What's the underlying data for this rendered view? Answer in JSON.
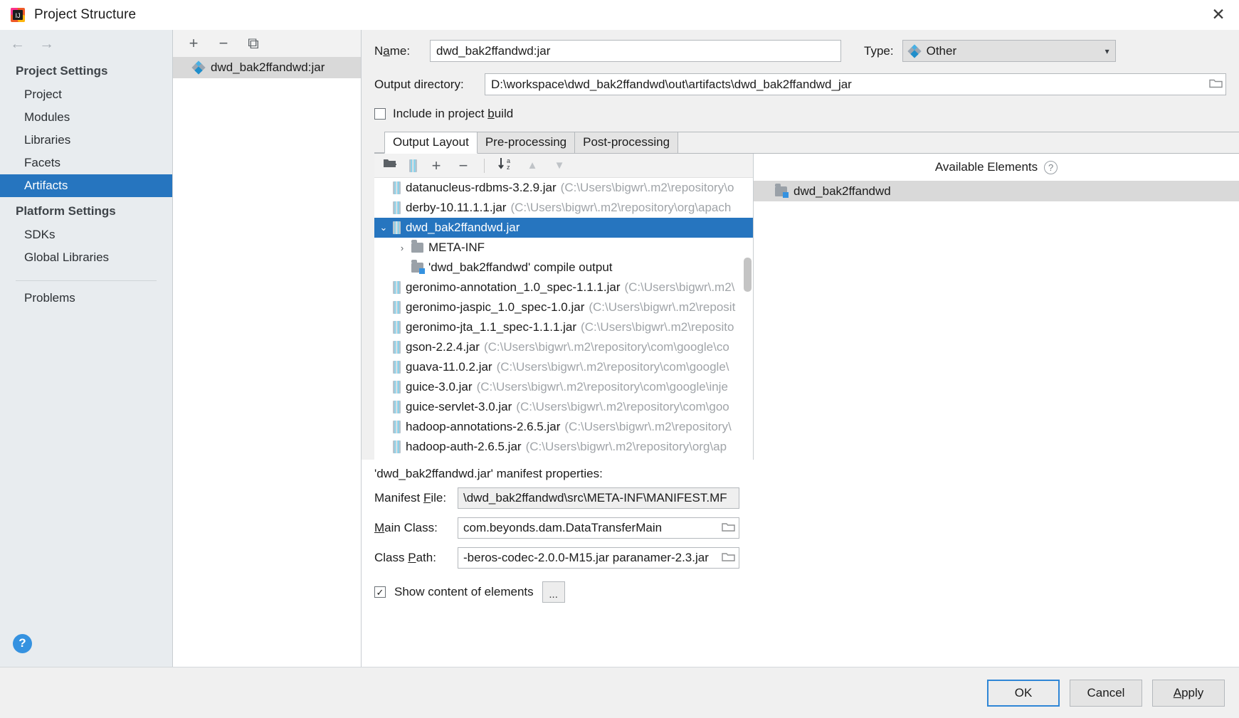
{
  "window": {
    "title": "Project Structure",
    "app_icon": "intellij-idea-icon",
    "close_label": "✕"
  },
  "nav": {
    "back": "←",
    "forward": "→"
  },
  "sidebar": {
    "groups": [
      {
        "label": "Project Settings",
        "items": [
          {
            "label": "Project",
            "selected": false
          },
          {
            "label": "Modules",
            "selected": false
          },
          {
            "label": "Libraries",
            "selected": false
          },
          {
            "label": "Facets",
            "selected": false
          },
          {
            "label": "Artifacts",
            "selected": true
          }
        ]
      },
      {
        "label": "Platform Settings",
        "items": [
          {
            "label": "SDKs",
            "selected": false
          },
          {
            "label": "Global Libraries",
            "selected": false
          }
        ]
      }
    ],
    "problems_label": "Problems",
    "help_glyph": "?"
  },
  "artifact_list": {
    "toolbar": {
      "add": "+",
      "remove": "−",
      "copy": "⧉"
    },
    "items": [
      {
        "label": "dwd_bak2ffandwd:jar",
        "icon": "artifact-diamond-icon",
        "selected": true
      }
    ]
  },
  "detail": {
    "name_label": "N",
    "name_label_mnemonic": "a",
    "name_label_rest": "me:",
    "name_value": "dwd_bak2ffandwd:jar",
    "type_label": "Type:",
    "type_value": "Other",
    "type_arrow": "▾",
    "output_dir_label": "Output directory:",
    "output_dir_value": "D:\\workspace\\dwd_bak2ffandwd\\out\\artifacts\\dwd_bak2ffandwd_jar",
    "include_in_build_pre": "Include in project ",
    "include_in_build_mnemonic": "b",
    "include_in_build_post": "uild",
    "include_in_build_checked": false,
    "browse_glyph": "▱"
  },
  "tabs": [
    {
      "label": "Output Layout",
      "active": true
    },
    {
      "label": "Pre-processing",
      "active": false
    },
    {
      "label": "Post-processing",
      "active": false
    }
  ],
  "layout_toolbar": {
    "create_directory": "folder-add-icon",
    "create_archive": "jar-archive-icon",
    "add": "+",
    "add_dropdown": "▾",
    "remove": "−",
    "sort": "sort-az-icon",
    "move_up": "▲",
    "move_down": "▼"
  },
  "tree": {
    "nodes": [
      {
        "indent": 0,
        "twist": "",
        "icon": "jar-icon",
        "name": "datanucleus-rdbms-3.2.9.jar",
        "path": "(C:\\Users\\bigwr\\.m2\\repository\\o",
        "selected": false
      },
      {
        "indent": 0,
        "twist": "",
        "icon": "jar-icon",
        "name": "derby-10.11.1.1.jar",
        "path": "(C:\\Users\\bigwr\\.m2\\repository\\org\\apach",
        "selected": false
      },
      {
        "indent": 0,
        "twist": "⌄",
        "icon": "jar-icon",
        "name": "dwd_bak2ffandwd.jar",
        "path": "",
        "selected": true
      },
      {
        "indent": 1,
        "twist": "›",
        "icon": "folder-icon",
        "name": "META-INF",
        "path": "",
        "selected": false
      },
      {
        "indent": 1,
        "twist": "",
        "icon": "module-output-icon",
        "name": "'dwd_bak2ffandwd' compile output",
        "path": "",
        "selected": false
      },
      {
        "indent": 0,
        "twist": "",
        "icon": "jar-icon",
        "name": "geronimo-annotation_1.0_spec-1.1.1.jar",
        "path": "(C:\\Users\\bigwr\\.m2\\",
        "selected": false
      },
      {
        "indent": 0,
        "twist": "",
        "icon": "jar-icon",
        "name": "geronimo-jaspic_1.0_spec-1.0.jar",
        "path": "(C:\\Users\\bigwr\\.m2\\reposit",
        "selected": false
      },
      {
        "indent": 0,
        "twist": "",
        "icon": "jar-icon",
        "name": "geronimo-jta_1.1_spec-1.1.1.jar",
        "path": "(C:\\Users\\bigwr\\.m2\\reposito",
        "selected": false
      },
      {
        "indent": 0,
        "twist": "",
        "icon": "jar-icon",
        "name": "gson-2.2.4.jar",
        "path": "(C:\\Users\\bigwr\\.m2\\repository\\com\\google\\co",
        "selected": false
      },
      {
        "indent": 0,
        "twist": "",
        "icon": "jar-icon",
        "name": "guava-11.0.2.jar",
        "path": "(C:\\Users\\bigwr\\.m2\\repository\\com\\google\\",
        "selected": false
      },
      {
        "indent": 0,
        "twist": "",
        "icon": "jar-icon",
        "name": "guice-3.0.jar",
        "path": "(C:\\Users\\bigwr\\.m2\\repository\\com\\google\\inje",
        "selected": false
      },
      {
        "indent": 0,
        "twist": "",
        "icon": "jar-icon",
        "name": "guice-servlet-3.0.jar",
        "path": "(C:\\Users\\bigwr\\.m2\\repository\\com\\goo",
        "selected": false
      },
      {
        "indent": 0,
        "twist": "",
        "icon": "jar-icon",
        "name": "hadoop-annotations-2.6.5.jar",
        "path": "(C:\\Users\\bigwr\\.m2\\repository\\",
        "selected": false
      },
      {
        "indent": 0,
        "twist": "",
        "icon": "jar-icon",
        "name": "hadoop-auth-2.6.5.jar",
        "path": "(C:\\Users\\bigwr\\.m2\\repository\\org\\ap",
        "selected": false
      }
    ]
  },
  "available": {
    "header": "Available Elements",
    "help_glyph": "?",
    "items": [
      {
        "label": "dwd_bak2ffandwd",
        "icon": "module-icon",
        "selected": true
      }
    ]
  },
  "manifest": {
    "title": "'dwd_bak2ffandwd.jar' manifest properties:",
    "file_label_pre": "Manifest ",
    "file_label_mnemonic": "F",
    "file_label_post": "ile:",
    "file_value": "\\dwd_bak2ffandwd\\src\\META-INF\\MANIFEST.MF",
    "main_class_label_mnemonic": "M",
    "main_class_label_post": "ain Class:",
    "main_class_value": "com.beyonds.dam.DataTransferMain",
    "class_path_label_pre": "Class ",
    "class_path_label_mnemonic": "P",
    "class_path_label_post": "ath:",
    "class_path_value": "-beros-codec-2.0.0-M15.jar paranamer-2.3.jar",
    "browse_glyph": "▱",
    "show_content_label": "Show content of elements",
    "show_content_checked": true,
    "dots_label": "..."
  },
  "buttons": {
    "ok": "OK",
    "cancel": "Cancel",
    "apply_mnemonic": "A",
    "apply_rest": "pply"
  },
  "colors": {
    "accent": "#2675bf",
    "default_button_border": "#2f86d6",
    "help_blue": "#3592e0"
  }
}
